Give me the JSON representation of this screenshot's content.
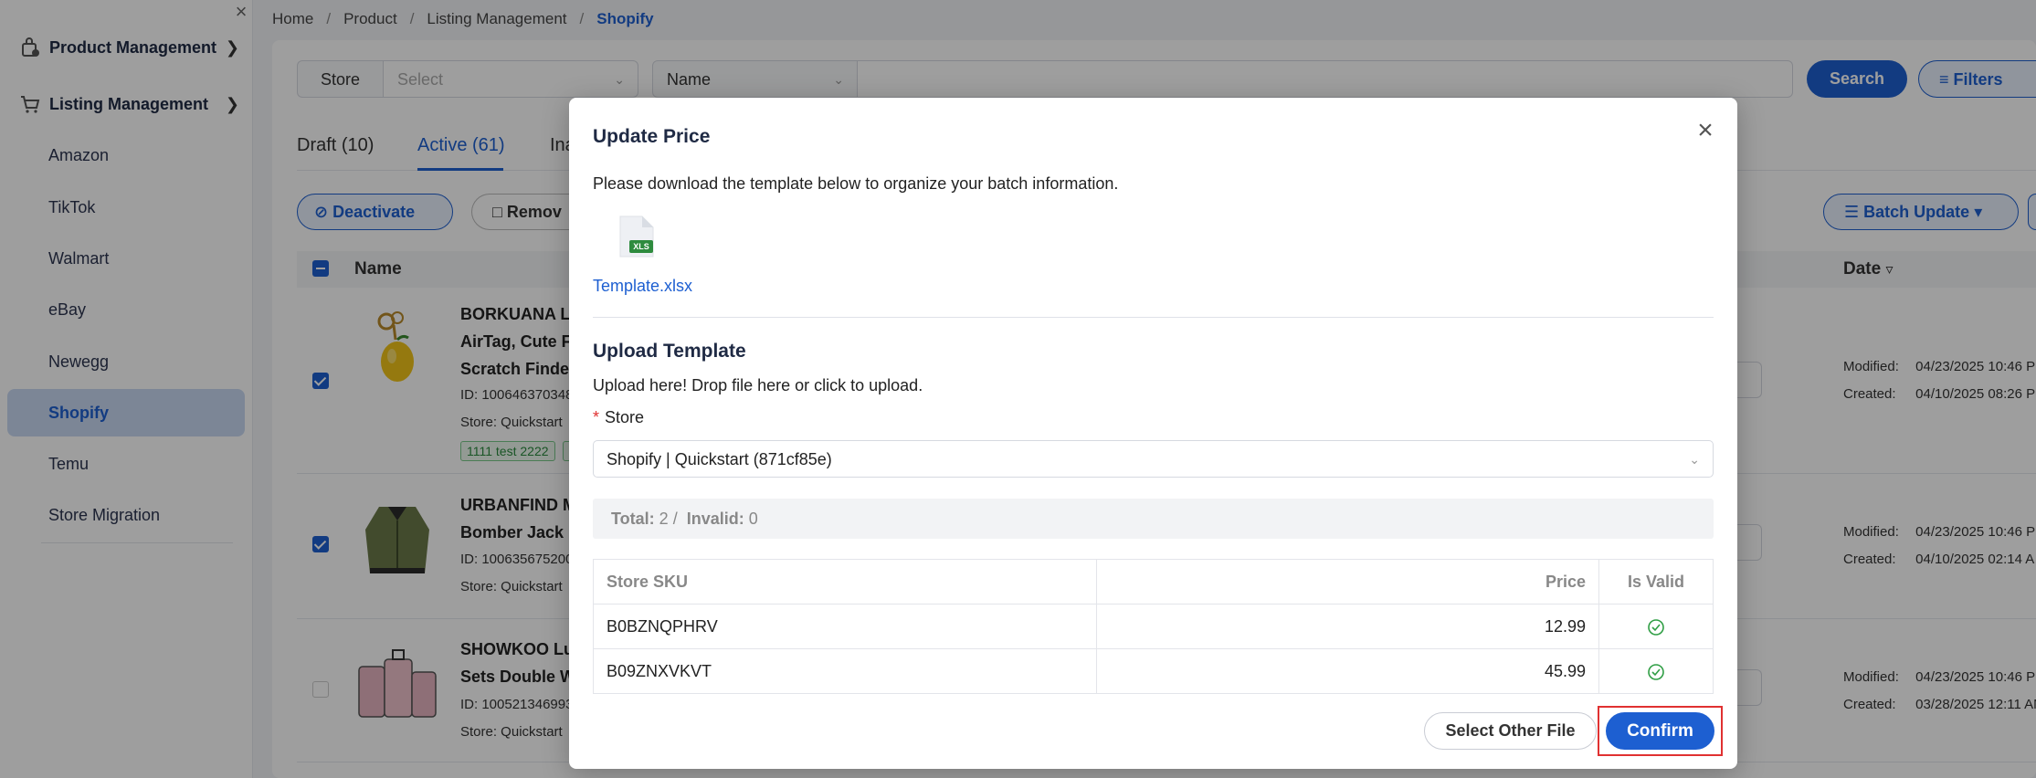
{
  "sidebar": {
    "groups": [
      {
        "label": "Product Management",
        "icon": "product-bag-icon",
        "chevron": "›"
      },
      {
        "label": "Listing Management",
        "icon": "cart-icon",
        "chevron": "⌄"
      }
    ],
    "items": [
      {
        "label": "Amazon"
      },
      {
        "label": "TikTok"
      },
      {
        "label": "Walmart"
      },
      {
        "label": "eBay"
      },
      {
        "label": "Newegg"
      },
      {
        "label": "Shopify",
        "active": true
      },
      {
        "label": "Temu"
      },
      {
        "label": "Store Migration"
      }
    ]
  },
  "breadcrumb": {
    "items": [
      "Home",
      "Product",
      "Listing Management",
      "Shopify"
    ],
    "separator": "/"
  },
  "filters": {
    "store_label": "Store",
    "store_placeholder": "Select",
    "name_select": "Name",
    "search_label": "Search",
    "filters_label": "Filters"
  },
  "tabs": [
    {
      "label": "Draft (10)"
    },
    {
      "label": "Active (61)",
      "active": true
    },
    {
      "label": "Ina"
    }
  ],
  "actions": {
    "deactivate_label": "Deactivate",
    "remove_label": "Remov",
    "batch_update_label": "Batch Update"
  },
  "table": {
    "col_name": "Name",
    "col_date": "Date",
    "rows": [
      {
        "checked": true,
        "title_lines": [
          "BORKUANA Le",
          "AirTag, Cute F",
          "Scratch Finde"
        ],
        "id": "ID: 100646370348",
        "store": "Store: Quickstart",
        "tags": [
          "1111 test 2222"
        ],
        "modified_label": "Modified:",
        "modified": "04/23/2025 10:46 P",
        "created_label": "Created:",
        "created": "04/10/2025 08:26 P"
      },
      {
        "checked": true,
        "title_lines": [
          "URBANFIND M",
          "Bomber Jack"
        ],
        "id": "ID: 100635675200",
        "store": "Store: Quickstart",
        "modified_label": "Modified:",
        "modified": "04/23/2025 10:46 P",
        "created_label": "Created:",
        "created": "04/10/2025 02:14 A"
      },
      {
        "checked": false,
        "title_lines": [
          "SHOWKOO Lu",
          "Sets Double W"
        ],
        "id": "ID: 100521346993",
        "store": "Store: Quickstart",
        "modified_label": "Modified:",
        "modified": "04/23/2025 10:46 P",
        "created_label": "Created:",
        "created": "03/28/2025 12:11 AM"
      }
    ]
  },
  "modal": {
    "title": "Update Price",
    "description": "Please download the template below to organize your batch information.",
    "file_badge": "XLS",
    "template_link": "Template.xlsx",
    "upload_title": "Upload Template",
    "upload_hint": "Upload here! Drop file here or click to upload.",
    "store_required_mark": "*",
    "store_label": "Store",
    "store_value": "Shopify | Quickstart (871cf85e)",
    "summary": {
      "total_label": "Total:",
      "total": "2",
      "sep": "/",
      "invalid_label": "Invalid:",
      "invalid": "0"
    },
    "columns": {
      "sku": "Store SKU",
      "price": "Price",
      "valid": "Is Valid"
    },
    "rows": [
      {
        "sku": "B0BZNQPHRV",
        "price": "12.99",
        "valid": true
      },
      {
        "sku": "B09ZNXVKVT",
        "price": "45.99",
        "valid": true
      }
    ],
    "select_other_label": "Select Other File",
    "confirm_label": "Confirm"
  },
  "colors": {
    "primary": "#1d5fd1",
    "highlight": "#e03131",
    "valid": "#2f9e44"
  }
}
